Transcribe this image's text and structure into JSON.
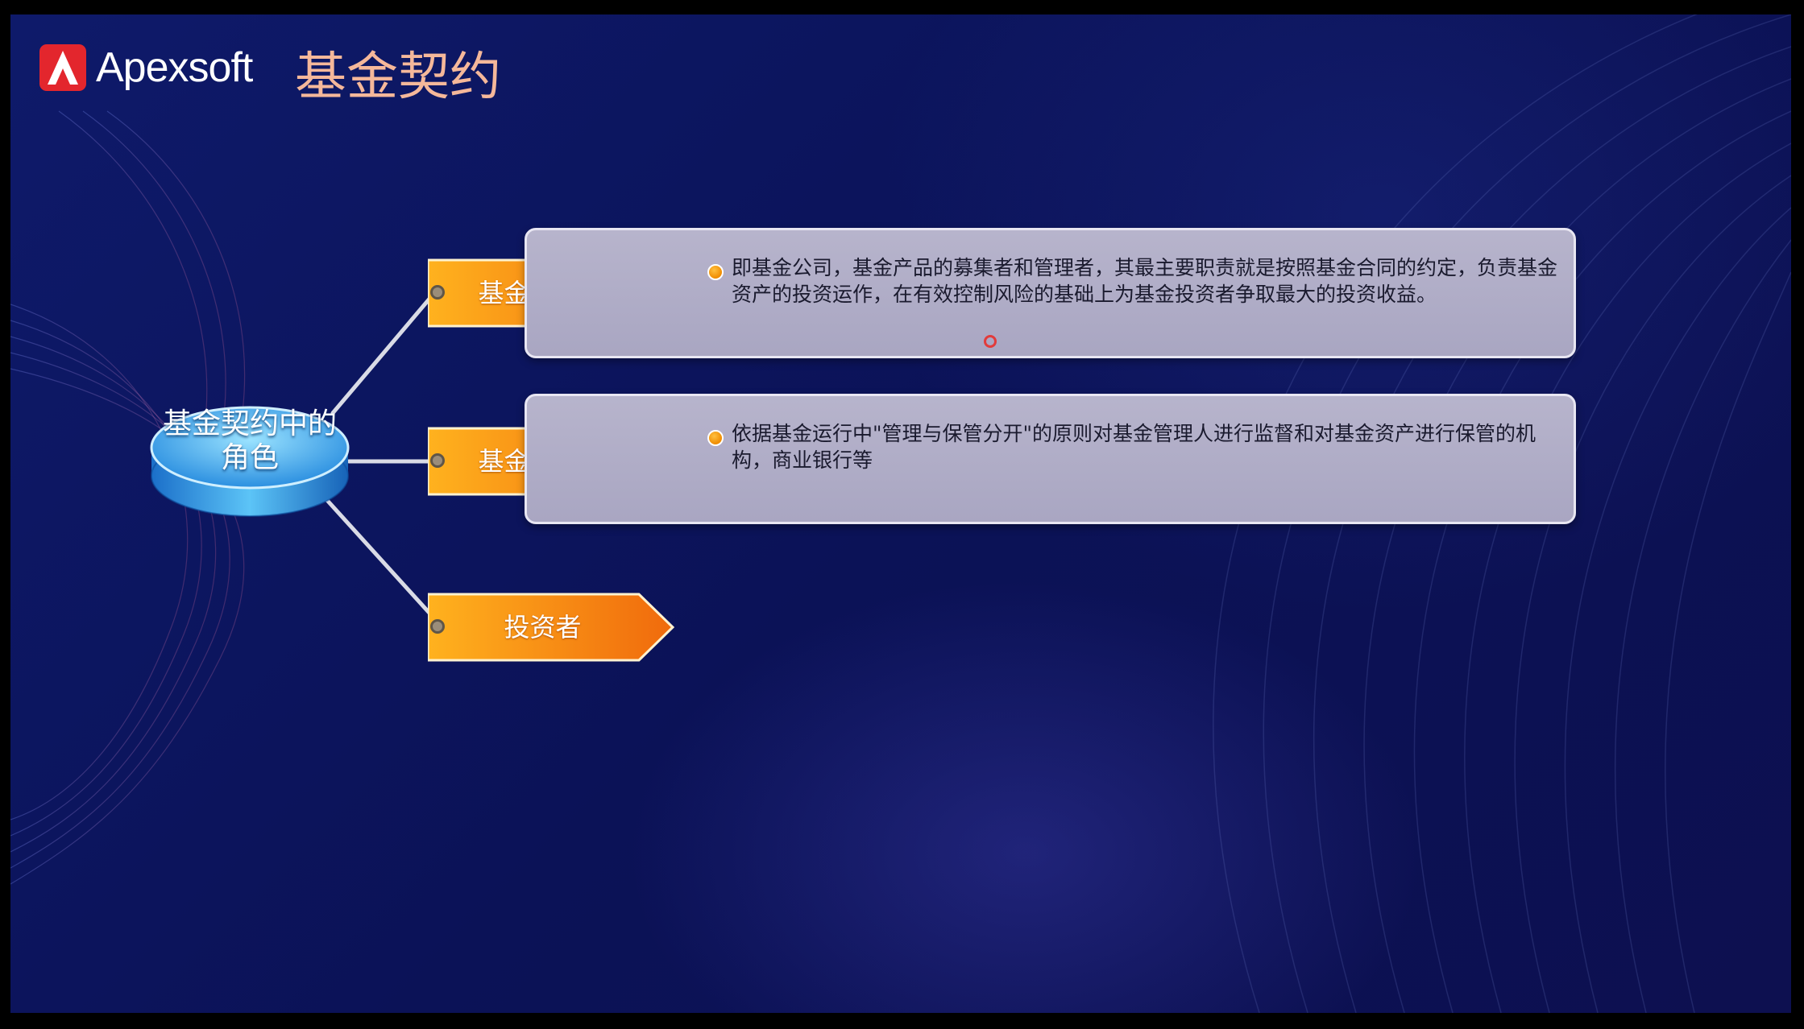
{
  "brand": {
    "name": "Apexsoft",
    "color": "#e3262d"
  },
  "slide": {
    "title": "基金契约"
  },
  "hub": {
    "label": "基金契约中的角色"
  },
  "roles": [
    {
      "label": "基金管理人",
      "description": "即基金公司，基金产品的募集者和管理者，其最主要职责就是按照基金合同的约定，负责基金资产的投资运作，在有效控制风险的基础上为基金投资者争取最大的投资收益。"
    },
    {
      "label": "基金托管人",
      "description": "依据基金运行中\"管理与保管分开\"的原则对基金管理人进行监督和对基金资产进行保管的机构，商业银行等"
    },
    {
      "label": "投资者"
    }
  ],
  "colors": {
    "accent": "#f5b89a",
    "tag": "#f39a1e",
    "background": "#0c1460",
    "card": "#b0adc7"
  }
}
